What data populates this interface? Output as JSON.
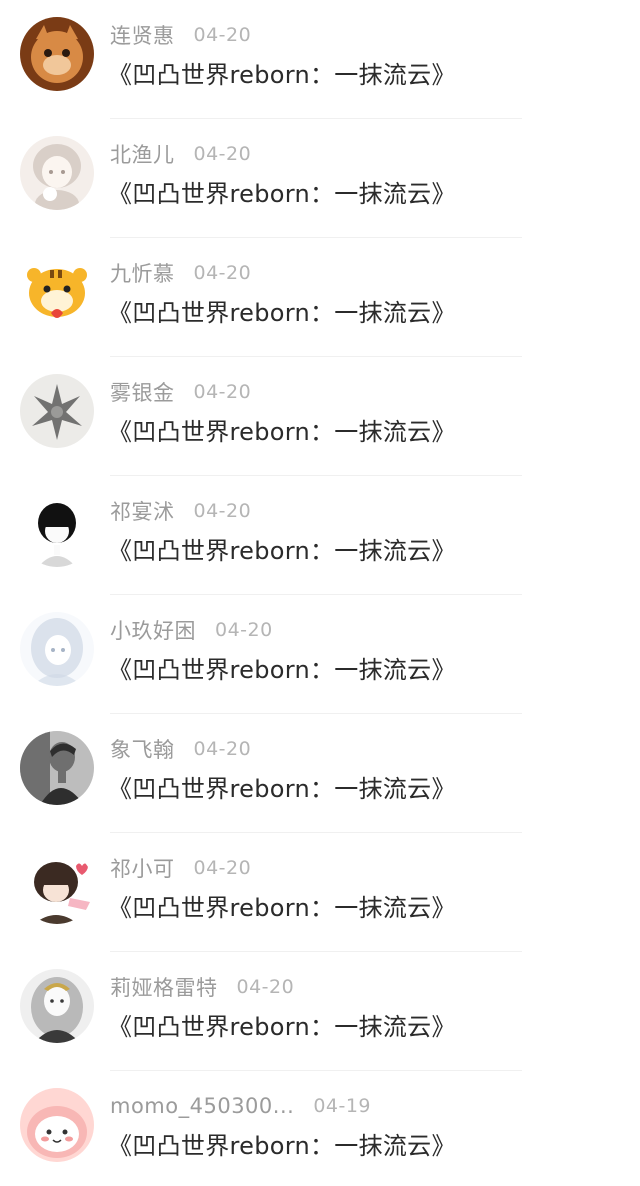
{
  "feed": {
    "items": [
      {
        "name": "连贤惠",
        "date": "04-20",
        "title": "《凹凸世界reborn：一抹流云》",
        "avatar_icon": "cat-face-avatar-icon",
        "avatar_colors": [
          "#7a3b15",
          "#d88a45",
          "#f1c79a"
        ]
      },
      {
        "name": "北渔儿",
        "date": "04-20",
        "title": "《凹凸世界reborn：一抹流云》",
        "avatar_icon": "anime-girl-avatar-icon",
        "avatar_colors": [
          "#f4eeea",
          "#d9cfc8",
          "#a89a92"
        ]
      },
      {
        "name": "九忻慕",
        "date": "04-20",
        "title": "《凹凸世界reborn：一抹流云》",
        "avatar_icon": "tiger-cartoon-avatar-icon",
        "avatar_colors": [
          "#ffffff",
          "#f7b52a",
          "#e8463a"
        ]
      },
      {
        "name": "雾银金",
        "date": "04-20",
        "title": "《凹凸世界reborn：一抹流云》",
        "avatar_icon": "dark-sketch-avatar-icon",
        "avatar_colors": [
          "#ecebe8",
          "#4a4a4a",
          "#9a9a98"
        ]
      },
      {
        "name": "祁宴沭",
        "date": "04-20",
        "title": "《凹凸世界reborn：一抹流云》",
        "avatar_icon": "black-hair-boy-avatar-icon",
        "avatar_colors": [
          "#ffffff",
          "#111111",
          "#d8d8d8"
        ]
      },
      {
        "name": "小玖好困",
        "date": "04-20",
        "title": "《凹凸世界reborn：一抹流云》",
        "avatar_icon": "white-hair-girl-avatar-icon",
        "avatar_colors": [
          "#f7f9fc",
          "#cfd8e6",
          "#a7b4c6"
        ]
      },
      {
        "name": "象飞翰",
        "date": "04-20",
        "title": "《凹凸世界reborn：一抹流云》",
        "avatar_icon": "grayscale-man-avatar-icon",
        "avatar_colors": [
          "#6f6f6f",
          "#2e2e2e",
          "#bdbdbd"
        ]
      },
      {
        "name": "祁小可",
        "date": "04-20",
        "title": "《凹凸世界reborn：一抹流云》",
        "avatar_icon": "anime-boy-hearts-avatar-icon",
        "avatar_colors": [
          "#ffffff",
          "#3b2a22",
          "#e85a6f"
        ]
      },
      {
        "name": "莉娅格雷特",
        "date": "04-20",
        "title": "《凹凸世界reborn：一抹流云》",
        "avatar_icon": "silver-hair-avatar-icon",
        "avatar_colors": [
          "#efefef",
          "#8c8c8c",
          "#3a3a3a"
        ]
      },
      {
        "name": "momo_450300...",
        "date": "04-19",
        "title": "《凹凸世界reborn：一抹流云》",
        "avatar_icon": "pink-blob-avatar-icon",
        "avatar_colors": [
          "#ffd7d3",
          "#f39c9c",
          "#ffffff"
        ]
      }
    ]
  }
}
